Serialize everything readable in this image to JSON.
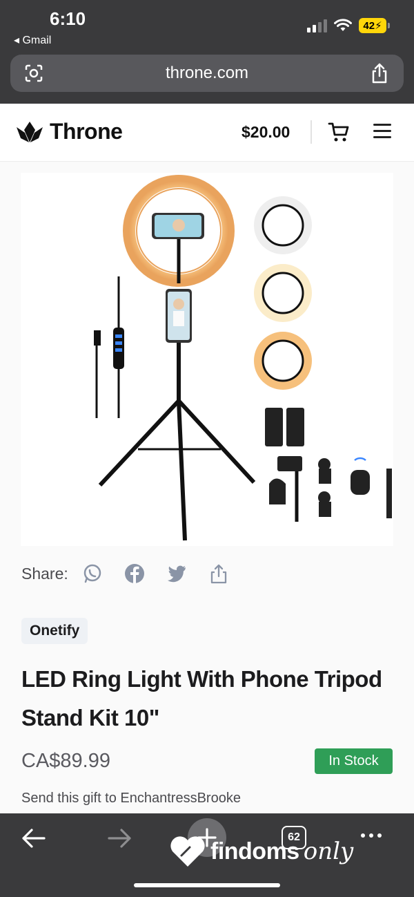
{
  "status_bar": {
    "time": "6:10",
    "back_app": "Gmail",
    "battery": "42"
  },
  "browser": {
    "url": "throne.com",
    "tabs_count": "62"
  },
  "site": {
    "brand": "Throne",
    "balance": "$20.00"
  },
  "product": {
    "share_label": "Share:",
    "share_icons": [
      "whatsapp-icon",
      "facebook-icon",
      "twitter-icon",
      "share-icon"
    ],
    "seller_badge": "Onetify",
    "title": "LED Ring Light With Phone Tripod Stand Kit 10\"",
    "price": "CA$89.99",
    "stock_status": "In Stock",
    "stock_color": "#2f9e57",
    "gift_text": "Send this gift to EnchantressBrooke"
  },
  "watermark": {
    "word": "findoms",
    "script": "only"
  }
}
